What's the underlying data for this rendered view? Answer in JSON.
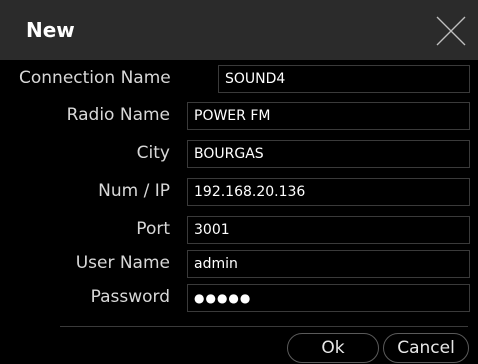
{
  "dialog": {
    "title": "New"
  },
  "form": {
    "connection_name": {
      "label": "Connection Name",
      "value": "SOUND4"
    },
    "radio_name": {
      "label": "Radio Name",
      "value": "POWER FM"
    },
    "city": {
      "label": "City",
      "value": "BOURGAS"
    },
    "num_ip": {
      "label": "Num / IP",
      "value": "192.168.20.136"
    },
    "port": {
      "label": "Port",
      "value": "3001"
    },
    "user_name": {
      "label": "User Name",
      "value": "admin"
    },
    "password": {
      "label": "Password",
      "value": "●●●●●"
    }
  },
  "buttons": {
    "ok": "Ok",
    "cancel": "Cancel"
  },
  "icons": {
    "close": "close-icon"
  }
}
